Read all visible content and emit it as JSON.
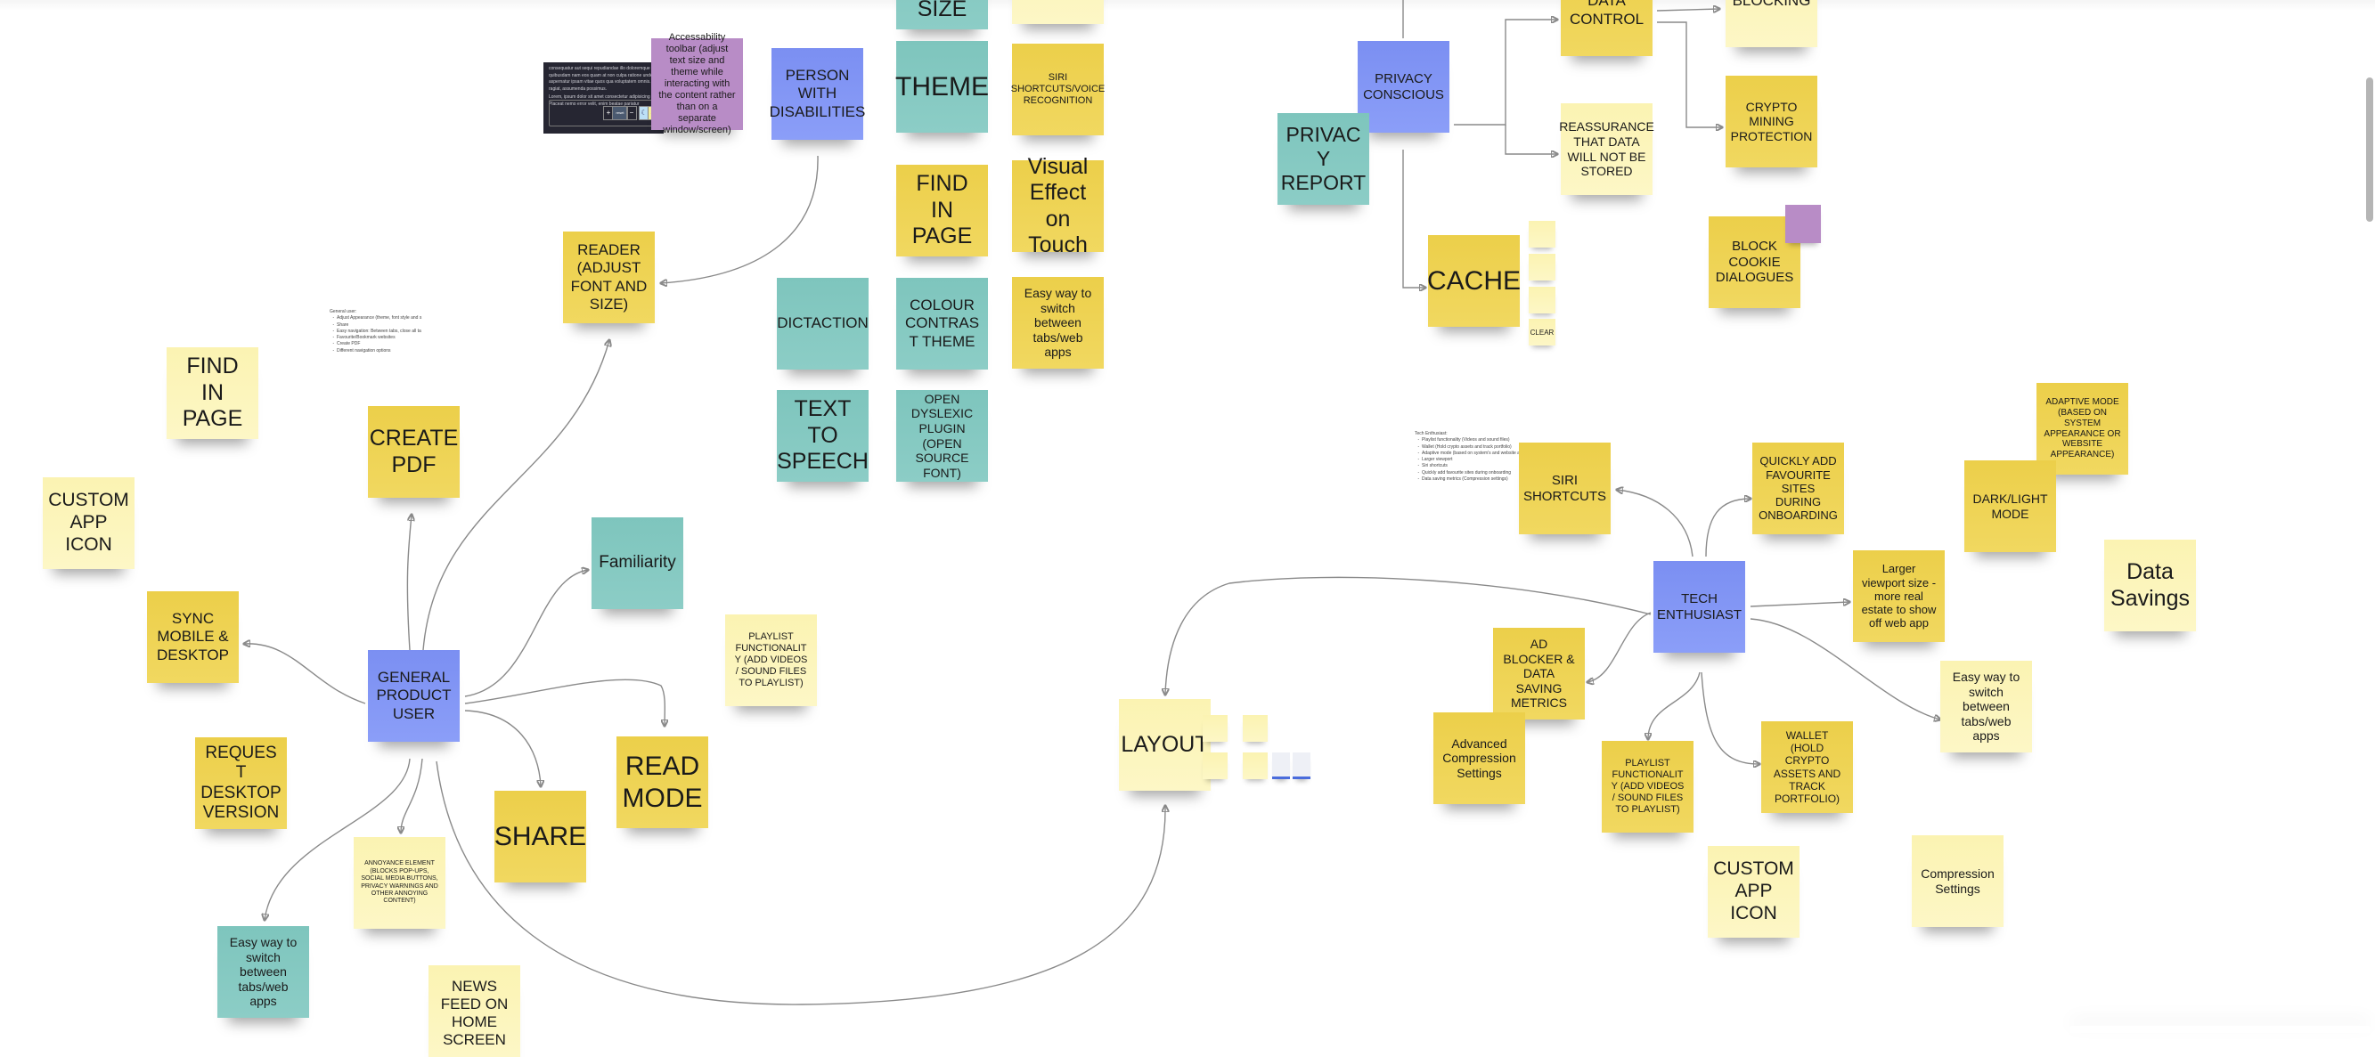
{
  "board": {
    "colors": {
      "yellow": "#eccf4a",
      "light_yellow": "#fbf3b2",
      "teal": "#7ec5bd",
      "blue": "#7b8ff2",
      "purple": "#b88cc6",
      "connector": "#8a8a8a"
    },
    "personas": {
      "general": "GENERAL PRODUCT USER",
      "disabilities": "PERSON WITH DISABILITIES",
      "privacy": "PRIVACY CONSCIOUS",
      "tech": "TECH ENTHUSIAST"
    },
    "accessibility": {
      "size": "SIZE",
      "theme": "THEME",
      "siri_voice": "SIRI SHORTCUTS/VOICE RECOGNITION",
      "find_in_page": "FIND IN PAGE",
      "visual_effect": "Visual Effect on Touch",
      "dictaction": "DICTACTION",
      "colour_contrast": "COLOUR CONTRAST THEME",
      "easy_switch": "Easy way to switch between tabs/web apps",
      "text_to_speech": "TEXT TO SPEECH",
      "open_dyslexic": "OPEN DYSLEXIC PLUGIN (OPEN SOURCE FONT)",
      "reader": "READER (ADJUST FONT AND SIZE)",
      "toolbar_note": "Accessability toolbar (adjust text size and theme while interacting with the content rather than on a separate window/screen)",
      "toolbar_screenshot": {
        "text1": "consequatur aut sequi repudiandae illo doloremque quibusdam nam eos quam at non culpa ratione unde aspernatur ipsam vitae quos qua voluptatem omnis. ragiat, assumenda possimus.",
        "text2": "Lorem, ipsum dolor sit amet consectetur adipisicing elit. Placeat nemo error velit, enim beatae pariatur",
        "plus": "+",
        "reset": "reset",
        "minus": "−",
        "moon": "☾",
        "sun": "☼"
      }
    },
    "general_user": {
      "find_in_page": "FIND IN PAGE",
      "create_pdf": "CREATE PDF",
      "custom_app_icon": "CUSTOM APP ICON",
      "sync": "SYNC MOBILE & DESKTOP",
      "request_desktop": "REQUEST DESKTOP VERSION",
      "familiarity": "Familiarity",
      "playlist": "PLAYLIST FUNCTIONALITY (ADD VIDEOS / SOUND FILES TO PLAYLIST)",
      "read_mode": "READ MODE",
      "share": "SHARE",
      "annoyance": "ANNOYANCE ELEMENT (BLOCKS POP-UPS, SOCIAL MEDIA BUTTONS, PRIVACY WARNINGS AND OTHER ANNOYING CONTENT)",
      "easy_switch": "Easy way to switch between tabs/web apps",
      "news_feed": "NEWS FEED ON HOME SCREEN",
      "note_title": "General user:",
      "note_items": [
        "Adjust Appearance (theme, font style and s",
        "Share",
        "Easy navigation: Between tabs, close all ta",
        "Favourite/Bookmark websites",
        "Create PDF",
        "Different navigation options"
      ]
    },
    "privacy": {
      "privacy_report": "PRIVACY REPORT",
      "data_control": "DATA CONTROL",
      "blocking": "BLOCKING",
      "crypto_mining": "CRYPTO MINING PROTECTION",
      "reassurance": "REASSURANCE THAT DATA WILL NOT BE STORED",
      "cache": "CACHE",
      "clear": "CLEAR",
      "block_cookie": "BLOCK COOKIE DIALOGUES"
    },
    "layout": {
      "label": "LAYOUT"
    },
    "tech": {
      "siri_shortcuts": "SIRI SHORTCUTS",
      "quick_add": "QUICKLY ADD FAVOURITE SITES DURING ONBOARDING",
      "adaptive_mode": "ADAPTIVE MODE (BASED ON SYSTEM APPEARANCE OR WEBSITE APPEARANCE)",
      "dark_light": "DARK/LIGHT MODE",
      "data_savings": "Data Savings",
      "larger_viewport": "Larger viewport size - more real estate to show off web app",
      "ad_blocker": "AD BLOCKER & DATA SAVING METRICS",
      "advanced_compression": "Advanced Compression Settings",
      "playlist": "PLAYLIST FUNCTIONALITY (ADD VIDEOS / SOUND FILES TO PLAYLIST)",
      "wallet": "WALLET (HOLD CRYPTO ASSETS AND TRACK PORTFOLIO)",
      "easy_switch": "Easy way to switch between tabs/web apps",
      "custom_app_icon": "CUSTOM APP ICON",
      "compression_settings": "Compression Settings",
      "note_title": "Tech Enthusiast:",
      "note_items": [
        "Playlist functionality (Videos and sound files)",
        "Wallet (Hold crypto assets and track portfolio)",
        "Adaptive mode (based on system's and website appeara",
        "Larger viewport",
        "Siri shortcuts",
        "Quickly add favourite sites during onboarding",
        "Data saving metrics (Compression settings)"
      ]
    }
  }
}
